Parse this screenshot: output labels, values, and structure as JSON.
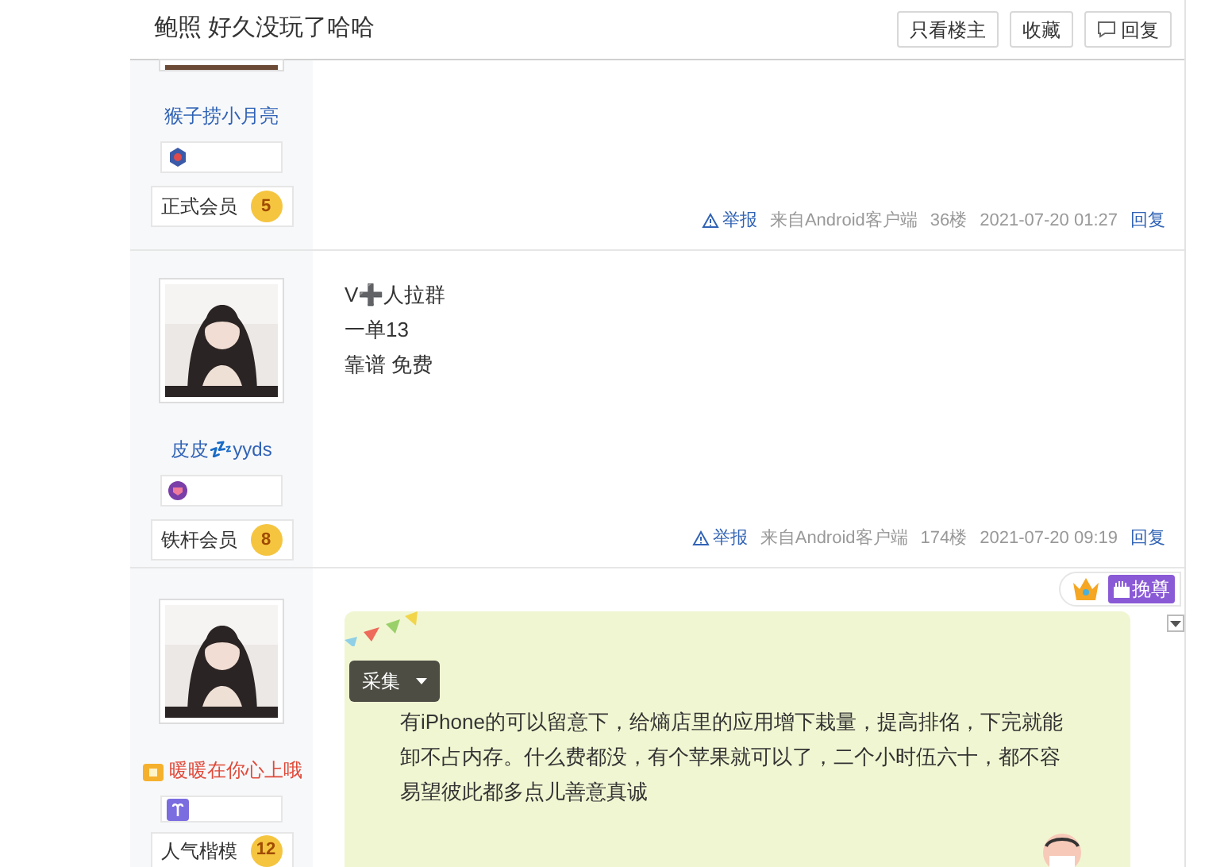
{
  "header": {
    "title": "鲍照 好久没玩了哈哈",
    "buttons": [
      {
        "label": "只看楼主",
        "kind": "text"
      },
      {
        "label": "收藏",
        "kind": "text"
      },
      {
        "label": "回复",
        "kind": "reply"
      }
    ]
  },
  "posts": [
    {
      "kind": "plain",
      "avatar": {
        "kind": "cropped"
      },
      "user": {
        "name": "猴子捞小月亮",
        "kind": "normal",
        "emblem": {
          "kind": "badge"
        },
        "member": "正式会员",
        "level": "5"
      },
      "footer": {
        "report": "举报",
        "source": "来自Android客户端",
        "floor": "36楼",
        "time": "2021-07-20 01:27",
        "reply": "回复"
      }
    },
    {
      "kind": "plain",
      "avatar": {
        "kind": "full"
      },
      "user": {
        "name": "皮皮💤yyds",
        "kind": "normal",
        "emblem": {
          "kind": "shield"
        },
        "member": "铁杆会员",
        "level": "8"
      },
      "lines": [
        "V➕人拉群",
        "一单13",
        "靠谱 免费"
      ],
      "footer": {
        "report": "举报",
        "source": "来自Android客户端",
        "floor": "174楼",
        "time": "2021-07-20 09:19",
        "reply": "回复"
      }
    },
    {
      "kind": "bubble",
      "avatar": {
        "kind": "full"
      },
      "user": {
        "name": "暖暖在你心上哦",
        "kind": "vip",
        "emblem": {
          "kind": "zodiac"
        },
        "member": "人气楷模",
        "level": "12"
      },
      "tag": "挽尊",
      "collect": "采集",
      "lines": [
        "有iPhone的可以留意下，给熵店里的应用增下栽量，提高排佲，下完就能卸不占内存。什么费都没，有个苹果就可以了，二个小时伍六十，都不容易望彼此都多点儿善意真诚"
      ]
    }
  ]
}
